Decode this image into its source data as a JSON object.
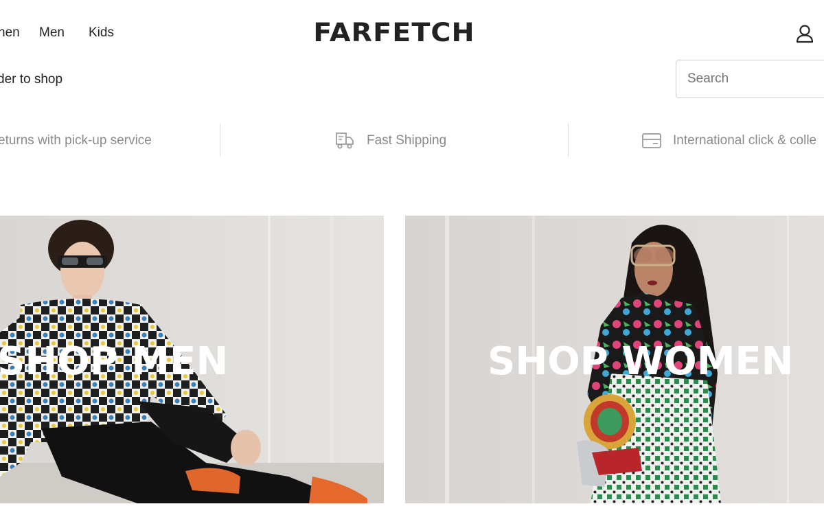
{
  "header": {
    "nav": {
      "women_partial": "nen",
      "men": "Men",
      "kids": "Kids"
    },
    "logo_text": "FARFETCH",
    "account_icon": "user-icon"
  },
  "subheader": {
    "text_partial": "der to shop",
    "search_placeholder": "Search"
  },
  "usp_bar": {
    "items": [
      {
        "label": "eturns with pick-up service"
      },
      {
        "label": "Fast Shipping",
        "icon": "delivery-truck-icon"
      },
      {
        "label": "International click & colle",
        "icon": "card-icon"
      }
    ]
  },
  "tiles": [
    {
      "title": "SHOP MEN"
    },
    {
      "title": "SHOP WOMEN"
    }
  ],
  "colors": {
    "text": "#222222",
    "muted": "#8a8a8a",
    "tile_bg": "#dcdad8",
    "hero_text": "#ffffff"
  }
}
